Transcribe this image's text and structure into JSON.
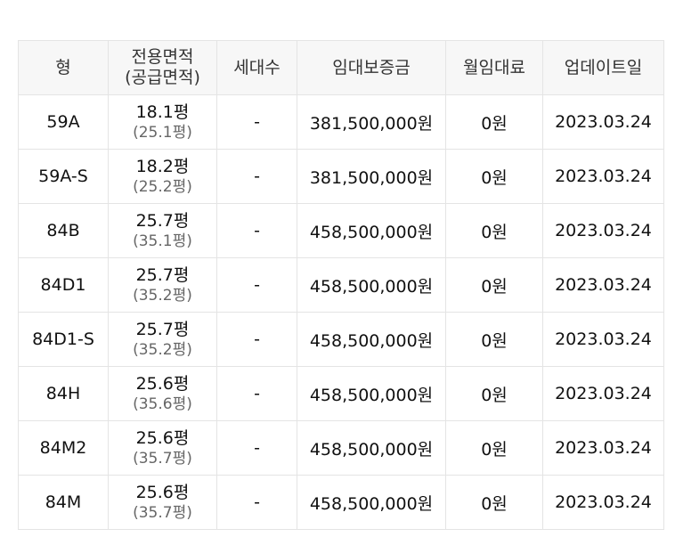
{
  "table": {
    "headers": {
      "type": "형",
      "area_line1": "전용면적",
      "area_line2": "(공급면적)",
      "households": "세대수",
      "deposit": "임대보증금",
      "monthly_rent": "월임대료",
      "update_date": "업데이트일"
    },
    "rows": [
      {
        "type": "59A",
        "area": "18.1평",
        "supply": "(25.1평)",
        "households": "-",
        "deposit": "381,500,000원",
        "rent": "0원",
        "date": "2023.03.24"
      },
      {
        "type": "59A-S",
        "area": "18.2평",
        "supply": "(25.2평)",
        "households": "-",
        "deposit": "381,500,000원",
        "rent": "0원",
        "date": "2023.03.24"
      },
      {
        "type": "84B",
        "area": "25.7평",
        "supply": "(35.1평)",
        "households": "-",
        "deposit": "458,500,000원",
        "rent": "0원",
        "date": "2023.03.24"
      },
      {
        "type": "84D1",
        "area": "25.7평",
        "supply": "(35.2평)",
        "households": "-",
        "deposit": "458,500,000원",
        "rent": "0원",
        "date": "2023.03.24"
      },
      {
        "type": "84D1-S",
        "area": "25.7평",
        "supply": "(35.2평)",
        "households": "-",
        "deposit": "458,500,000원",
        "rent": "0원",
        "date": "2023.03.24"
      },
      {
        "type": "84H",
        "area": "25.6평",
        "supply": "(35.6평)",
        "households": "-",
        "deposit": "458,500,000원",
        "rent": "0원",
        "date": "2023.03.24"
      },
      {
        "type": "84M2",
        "area": "25.6평",
        "supply": "(35.7평)",
        "households": "-",
        "deposit": "458,500,000원",
        "rent": "0원",
        "date": "2023.03.24"
      },
      {
        "type": "84M",
        "area": "25.6평",
        "supply": "(35.7평)",
        "households": "-",
        "deposit": "458,500,000원",
        "rent": "0원",
        "date": "2023.03.24"
      }
    ]
  }
}
